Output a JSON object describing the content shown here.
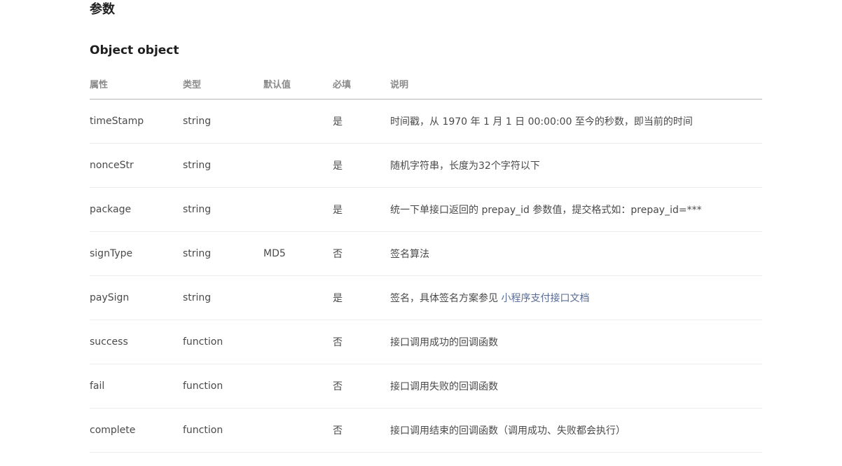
{
  "section_title": "参数",
  "object_title": "Object object",
  "table": {
    "headers": [
      "属性",
      "类型",
      "默认值",
      "必填",
      "说明"
    ],
    "rows": [
      {
        "name": "timeStamp",
        "type": "string",
        "default": "",
        "required": "是",
        "description": "时间戳，从 1970 年 1 月 1 日 00:00:00 至今的秒数，即当前的时间",
        "link": ""
      },
      {
        "name": "nonceStr",
        "type": "string",
        "default": "",
        "required": "是",
        "description": "随机字符串，长度为32个字符以下",
        "link": ""
      },
      {
        "name": "package",
        "type": "string",
        "default": "",
        "required": "是",
        "description": "统一下单接口返回的 prepay_id 参数值，提交格式如：prepay_id=***",
        "link": ""
      },
      {
        "name": "signType",
        "type": "string",
        "default": "MD5",
        "required": "否",
        "description": "签名算法",
        "link": ""
      },
      {
        "name": "paySign",
        "type": "string",
        "default": "",
        "required": "是",
        "description": "签名，具体签名方案参见 ",
        "link": "小程序支付接口文档"
      },
      {
        "name": "success",
        "type": "function",
        "default": "",
        "required": "否",
        "description": "接口调用成功的回调函数",
        "link": ""
      },
      {
        "name": "fail",
        "type": "function",
        "default": "",
        "required": "否",
        "description": "接口调用失败的回调函数",
        "link": ""
      },
      {
        "name": "complete",
        "type": "function",
        "default": "",
        "required": "否",
        "description": "接口调用结束的回调函数（调用成功、失败都会执行）",
        "link": ""
      }
    ]
  },
  "colors": {
    "link": "#576b95",
    "header_text": "#8a8a8a",
    "body_text": "#4a4a4a"
  }
}
